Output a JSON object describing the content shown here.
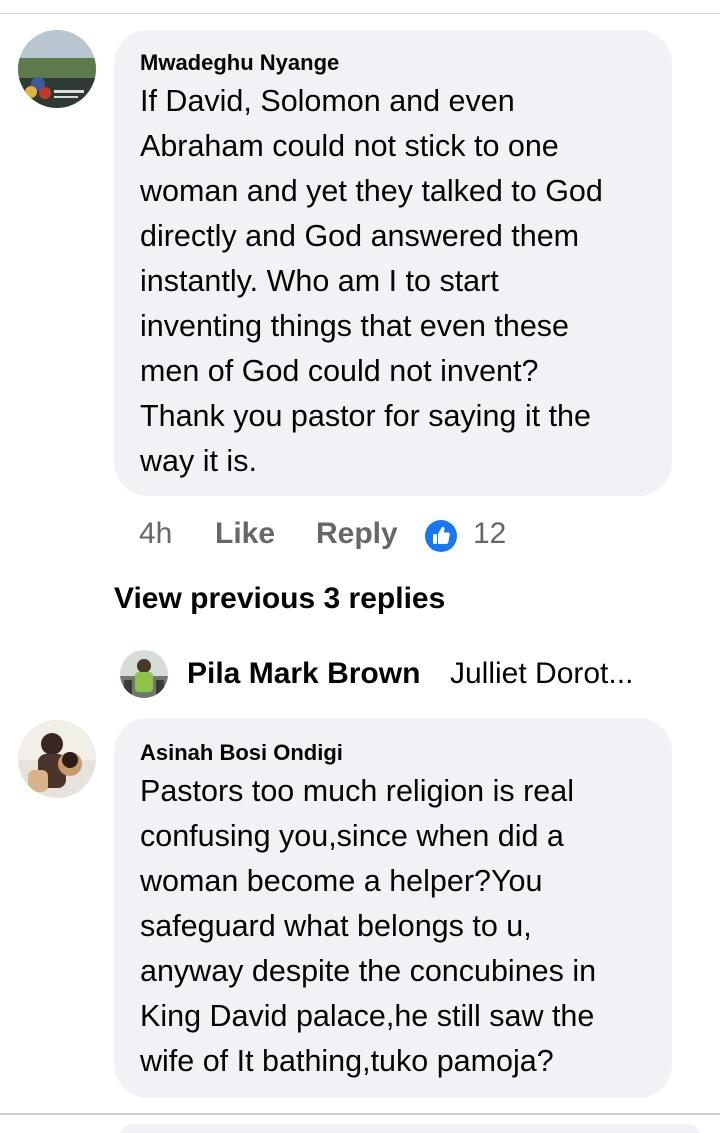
{
  "comments": [
    {
      "author": "Mwadeghu Nyange",
      "lines": [
        "If David, Solomon and even",
        "Abraham could not stick to one",
        "woman and yet they talked to God",
        "directly and God answered them",
        "instantly. Who am I to start",
        "inventing things that even these",
        "men of God could not invent?",
        "Thank you pastor for saying it the",
        "way it is."
      ],
      "time": "4h",
      "like_label": "Like",
      "reply_label": "Reply",
      "reaction_count": "12"
    },
    {
      "author": "Asinah Bosi Ondigi",
      "lines": [
        "Pastors too much religion is real",
        "confusing you,since when did a",
        "woman become a helper?You",
        "safeguard what belongs to u,",
        "anyway despite the concubines in",
        "King David palace,he still saw the",
        "wife of It bathing,tuko pamoja?"
      ]
    }
  ],
  "view_previous_replies": "View previous 3 replies",
  "latest_reply": {
    "author": "Pila Mark Brown",
    "preview": "Julliet Dorot..."
  },
  "colors": {
    "bubble": "#f0f2f5",
    "meta_text": "#65676b",
    "like_blue": "#1877f2"
  },
  "icons": {
    "reaction": "like-thumb-icon"
  }
}
